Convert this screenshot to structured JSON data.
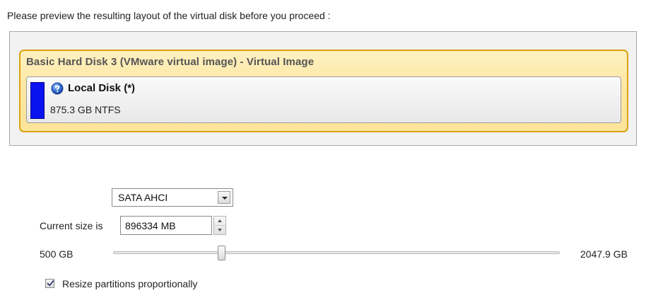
{
  "prompt": "Please preview the resulting layout of the virtual disk before you proceed :",
  "disk": {
    "title": "Basic Hard Disk 3 (VMware virtual image) - Virtual Image",
    "partition": {
      "name": "Local Disk (*)",
      "size_fs": "875.3 GB NTFS",
      "color": "#0a12f0",
      "icon": "help-icon"
    },
    "selected_color": "#fde7a2"
  },
  "controller": {
    "selected": "SATA AHCI"
  },
  "size": {
    "label": "Current size is",
    "value": "896334 MB"
  },
  "slider": {
    "min_label": "500 GB",
    "max_label": "2047.9 GB",
    "min_gb": 500,
    "max_gb": 2047.9,
    "value_gb": 875.3
  },
  "options": {
    "resize_label": "Resize partitions proportionally",
    "resize_checked": true
  }
}
